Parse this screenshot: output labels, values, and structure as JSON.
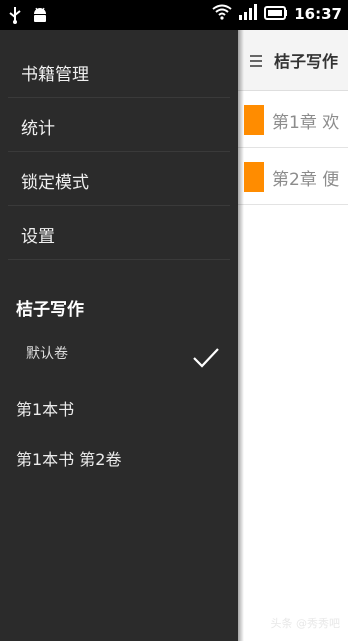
{
  "status_bar": {
    "time": "16:37",
    "icons": [
      "usb-icon",
      "android-icon",
      "wifi-icon",
      "signal-icon",
      "battery-icon"
    ]
  },
  "drawer": {
    "menu": [
      {
        "label": "书籍管理"
      },
      {
        "label": "统计"
      },
      {
        "label": "锁定模式"
      },
      {
        "label": "设置"
      }
    ],
    "section_title": "桔子写作",
    "volumes": [
      {
        "label": "默认卷",
        "checked": true
      }
    ],
    "books": [
      {
        "label": "第1本书"
      },
      {
        "label": "第1本书 第2卷"
      }
    ]
  },
  "main": {
    "title": "桔子写作",
    "chapters": [
      {
        "label": "第1章 欢"
      },
      {
        "label": "第2章 便"
      }
    ],
    "accent_color": "#ff8c00"
  },
  "watermark": "头条 @秀秀吧"
}
